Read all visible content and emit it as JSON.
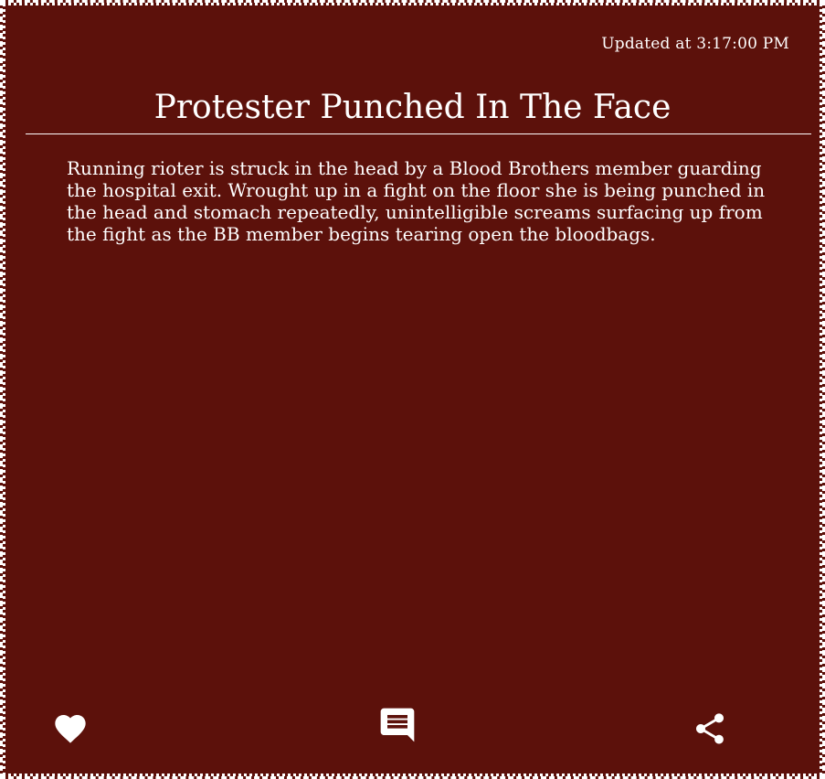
{
  "card": {
    "updated_label": "Updated at 3:17:00 PM",
    "title": "Protester Punched In The Face",
    "body": "Running rioter is struck in the head by a Blood Brothers member guarding the hospital exit. Wrought up in a fight on the floor she is being punched in the head and stomach repeatedly, unintelligible screams surfacing up from the fight as the BB member begins tearing open the bloodbags."
  },
  "actions": {
    "like_icon": "heart-icon",
    "comment_icon": "comment-icon",
    "share_icon": "share-icon"
  },
  "colors": {
    "background": "#5c110b",
    "foreground": "#ffffff"
  }
}
